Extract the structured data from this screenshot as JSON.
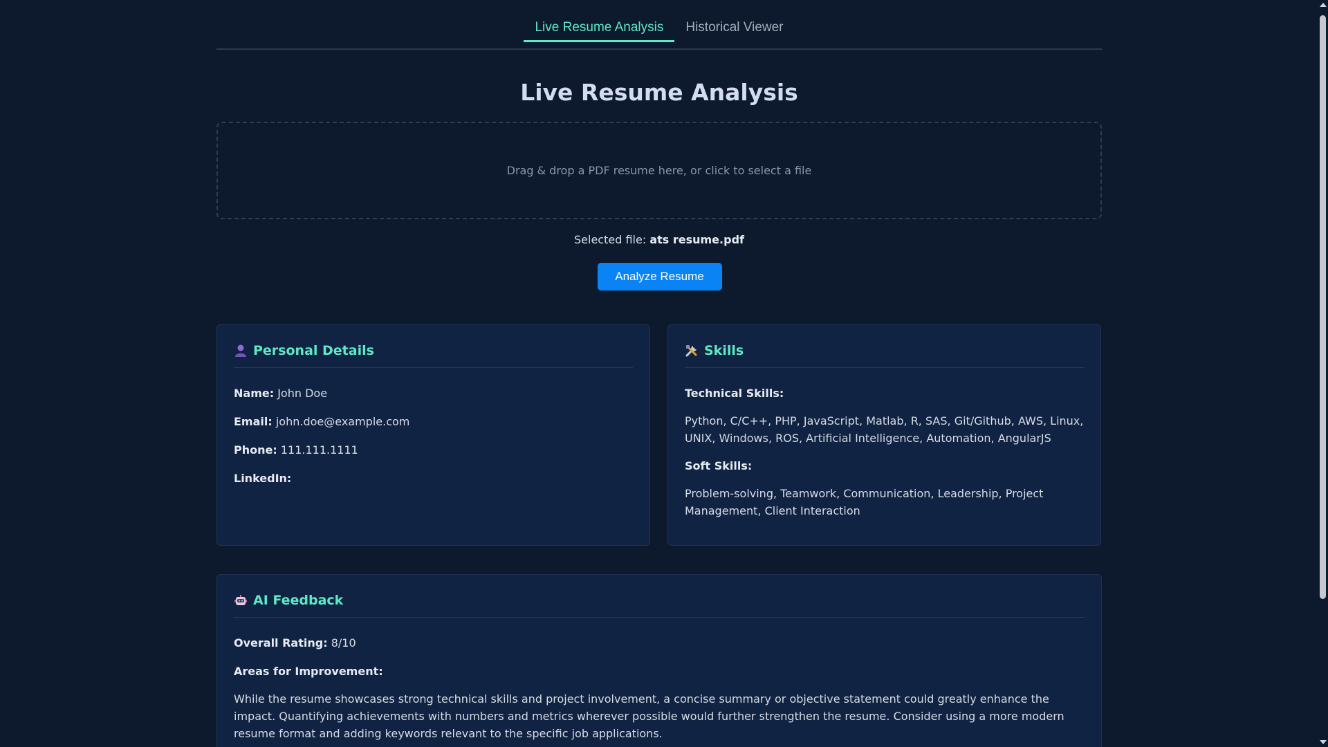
{
  "tabs": [
    {
      "label": "Live Resume Analysis",
      "active": true
    },
    {
      "label": "Historical Viewer",
      "active": false
    }
  ],
  "page_title": "Live Resume Analysis",
  "dropzone": {
    "text": "Drag & drop a PDF resume here, or click to select a file"
  },
  "selected_file": {
    "label": "Selected file:",
    "name": "ats resume.pdf"
  },
  "analyze_button": "Analyze Resume",
  "personal": {
    "title": "Personal Details",
    "icon": "person-icon",
    "name_label": "Name:",
    "name_value": "John Doe",
    "email_label": "Email:",
    "email_value": "john.doe@example.com",
    "phone_label": "Phone:",
    "phone_value": "111.111.1111",
    "linkedin_label": "LinkedIn:",
    "linkedin_value": ""
  },
  "skills": {
    "title": "Skills",
    "icon": "tools-icon",
    "technical_label": "Technical Skills:",
    "technical_value": "Python, C/C++, PHP, JavaScript, Matlab, R, SAS, Git/Github, AWS, Linux, UNIX, Windows, ROS, Artificial Intelligence, Automation, AngularJS",
    "soft_label": "Soft Skills:",
    "soft_value": "Problem-solving, Teamwork, Communication, Leadership, Project Management, Client Interaction"
  },
  "feedback": {
    "title": "AI Feedback",
    "icon": "robot-icon",
    "rating_label": "Overall Rating:",
    "rating_value": "8/10",
    "improve_label": "Areas for Improvement:",
    "improve_value": "While the resume showcases strong technical skills and project involvement, a concise summary or objective statement could greatly enhance the impact. Quantifying achievements with numbers and metrics wherever possible would further strengthen the resume. Consider using a more modern resume format and adding keywords relevant to the specific job applications."
  },
  "colors": {
    "accent": "#5ee8c5",
    "button": "#0a84f5",
    "background": "#0d1a2e",
    "card": "#112342"
  }
}
